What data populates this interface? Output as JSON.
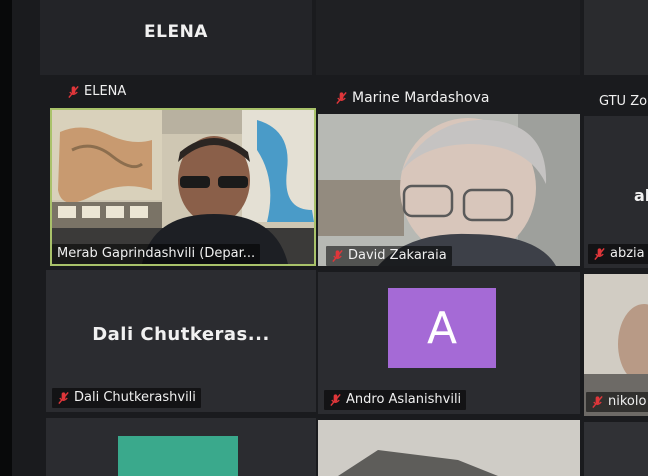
{
  "speaker_strip": {
    "name": "ELENA"
  },
  "tiles": {
    "elena": {
      "label": "ELENA"
    },
    "marine": {
      "label": "Marine Mardashova"
    },
    "gtu": {
      "label": "GTU Zo"
    },
    "merab": {
      "label": "Merab Gaprindashvili (Depar..."
    },
    "david": {
      "label": "David Zakaraia"
    },
    "abzia": {
      "center": "ab",
      "label": "abzia"
    },
    "dali": {
      "center": "Dali Chutkeras...",
      "label": "Dali Chutkerashvili"
    },
    "andro": {
      "avatar_letter": "A",
      "label": "Andro Aslanishvili"
    },
    "nikolo": {
      "label": "nikolo"
    }
  },
  "icons": {
    "muted": "mic-off-icon"
  },
  "colors": {
    "active_speaker_border": "#a9c26a",
    "muted_icon": "#e0363a",
    "avatar_bg": "#a56ad6",
    "tile_bg": "#26282c"
  }
}
